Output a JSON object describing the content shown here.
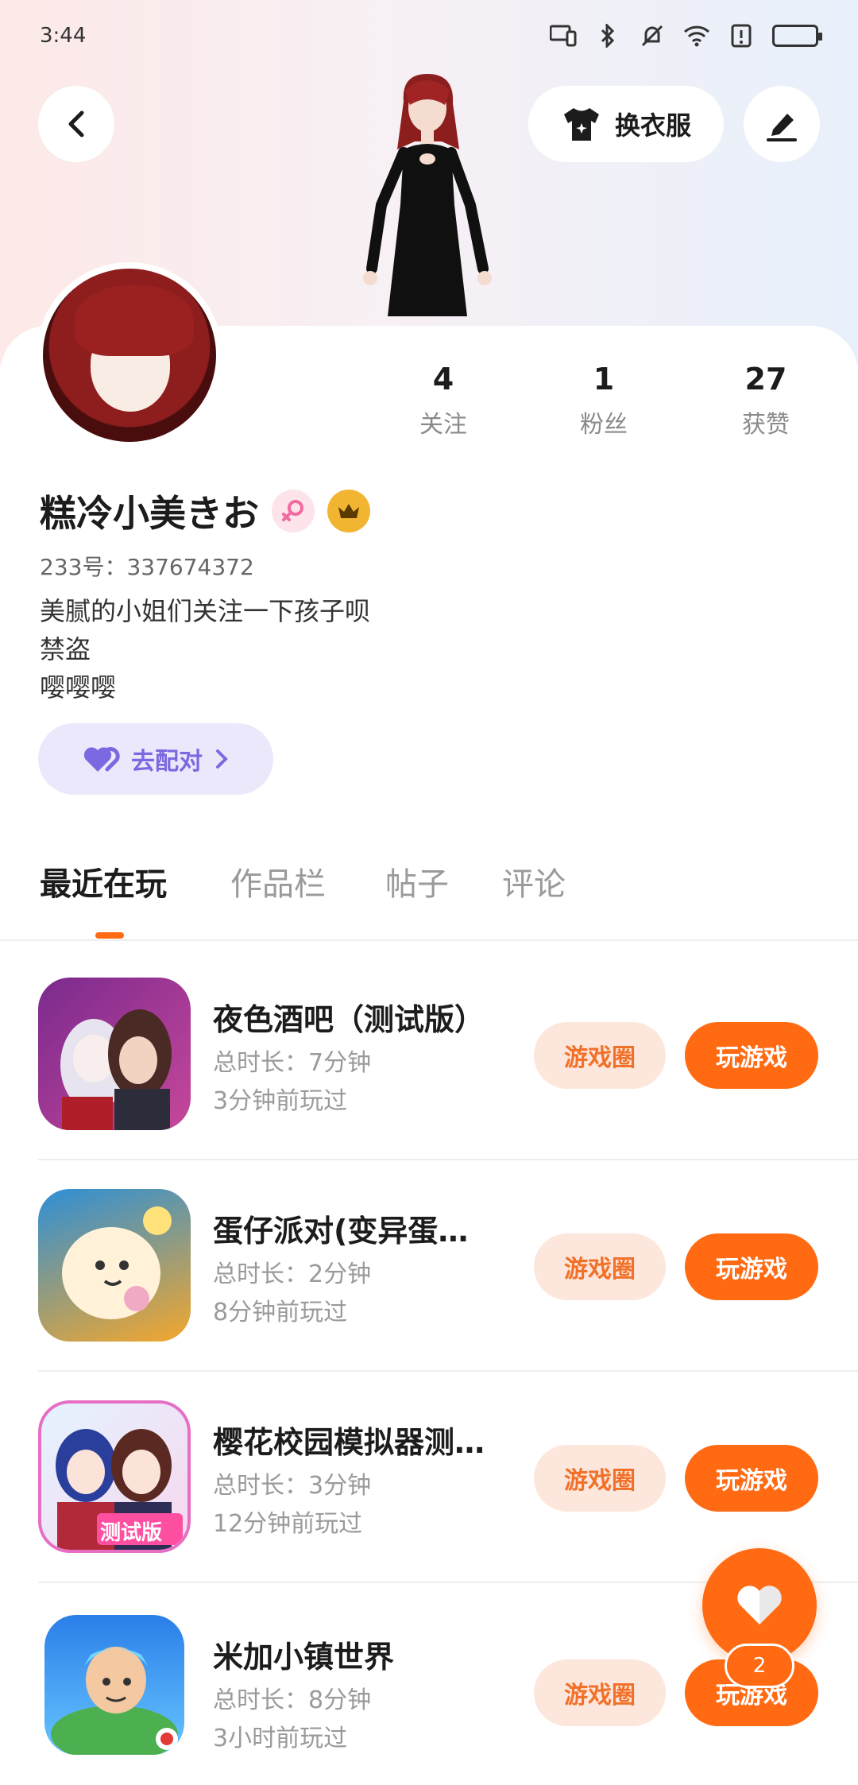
{
  "status_bar": {
    "time": "3:44"
  },
  "header": {
    "dress_up_label": "换衣服"
  },
  "profile": {
    "stats": [
      {
        "value": "4",
        "label": "关注"
      },
      {
        "value": "1",
        "label": "粉丝"
      },
      {
        "value": "27",
        "label": "获赞"
      }
    ],
    "name": "糕冷小美きお",
    "id_line": "233号：337674372",
    "bio_lines": [
      "美腻的小姐们关注一下孩子呗",
      "禁盗",
      "嘤嘤嘤"
    ],
    "match_label": "去配对",
    "gender_badge_color": "#f06ba0",
    "vip_badge_color": "#f2b531"
  },
  "tabs": [
    "最近在玩",
    "作品栏",
    "帖子",
    "评论"
  ],
  "games": [
    {
      "title": "夜色酒吧（测试版）",
      "duration": "总时长：7分钟",
      "last_played": "3分钟前玩过",
      "circle_label": "游戏圈",
      "play_label": "玩游戏"
    },
    {
      "title": "蛋仔派对(变异蛋…",
      "duration": "总时长：2分钟",
      "last_played": "8分钟前玩过",
      "circle_label": "游戏圈",
      "play_label": "玩游戏"
    },
    {
      "title": "樱花校园模拟器测…",
      "duration": "总时长：3分钟",
      "last_played": "12分钟前玩过",
      "circle_label": "游戏圈",
      "play_label": "玩游戏"
    },
    {
      "title": "米加小镇世界",
      "duration": "总时长：8分钟",
      "last_played": "3小时前玩过",
      "circle_label": "游戏圈",
      "play_label": "玩游戏"
    }
  ],
  "game_icon_texts": {
    "sakura_badge": "测试版"
  },
  "fab": {
    "count": "2"
  },
  "colors": {
    "accent": "#ff6a13",
    "match": "#7a69e0"
  }
}
